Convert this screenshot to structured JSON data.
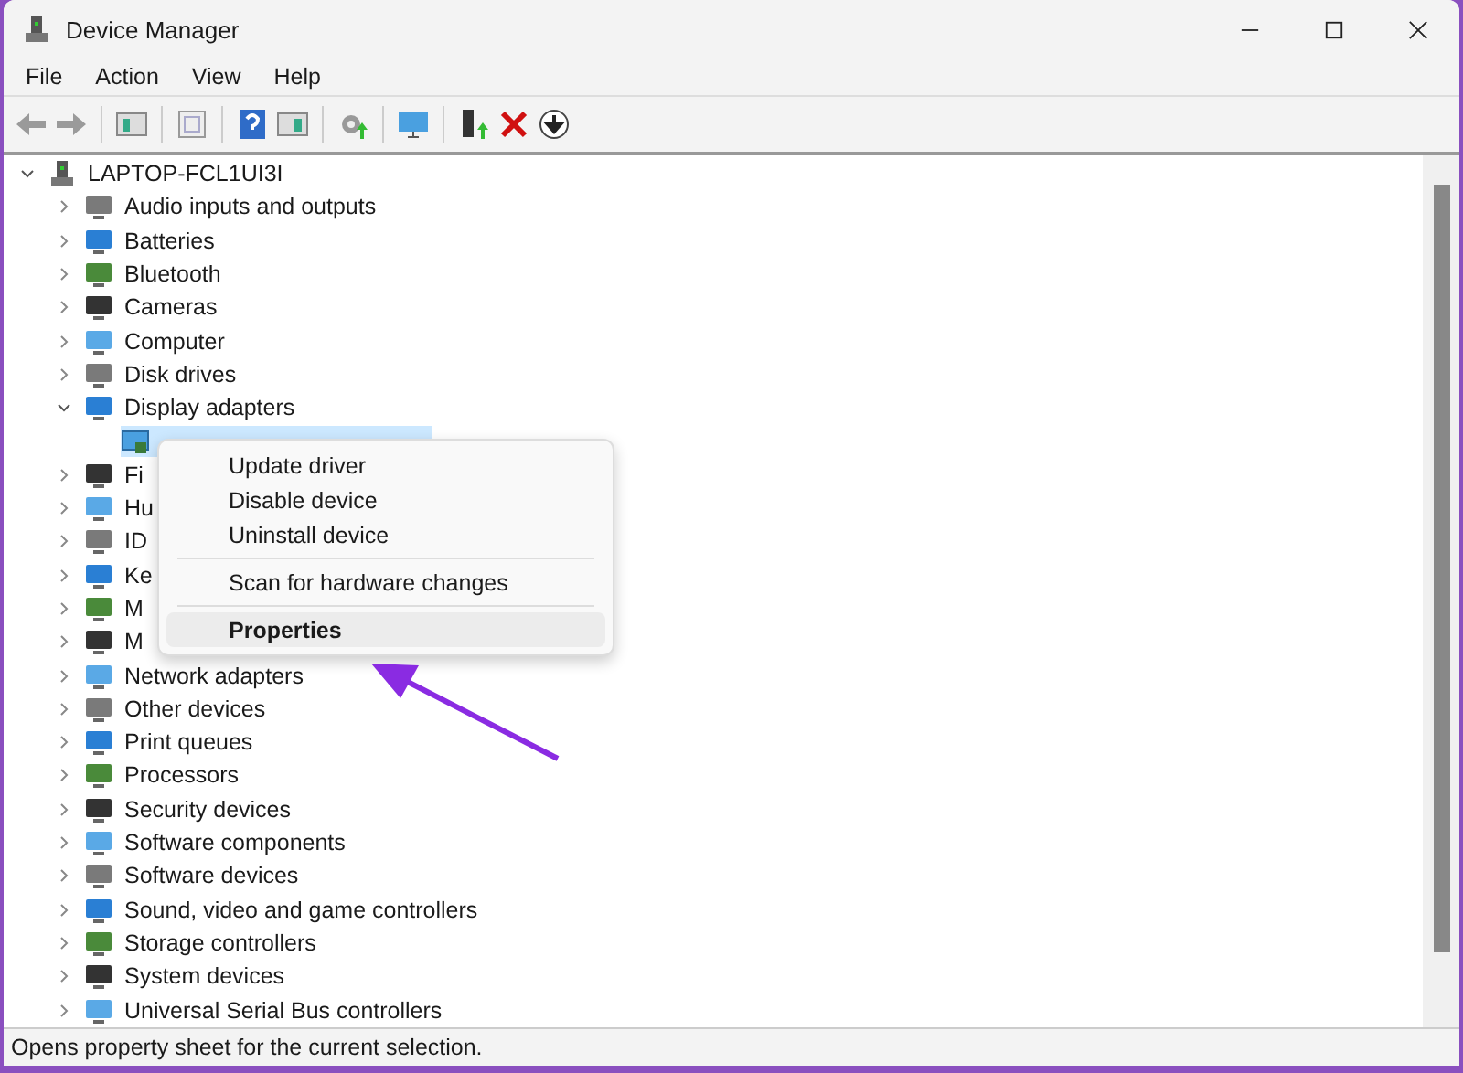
{
  "window": {
    "title": "Device Manager"
  },
  "menu_bar": [
    "File",
    "Action",
    "View",
    "Help"
  ],
  "tree": {
    "label": "LAPTOP-FCL1UI3I",
    "expanded": true,
    "children": [
      {
        "label": "Audio inputs and outputs",
        "expanded": false
      },
      {
        "label": "Batteries",
        "expanded": false
      },
      {
        "label": "Bluetooth",
        "expanded": false
      },
      {
        "label": "Cameras",
        "expanded": false
      },
      {
        "label": "Computer",
        "expanded": false
      },
      {
        "label": "Disk drives",
        "expanded": false
      },
      {
        "label": "Display adapters",
        "expanded": true,
        "children": [
          {
            "selected": true
          }
        ]
      },
      {
        "label": "Fi",
        "expanded": false
      },
      {
        "label": "Hu",
        "expanded": false
      },
      {
        "label": "ID",
        "expanded": false
      },
      {
        "label": "Ke",
        "expanded": false
      },
      {
        "label": "M",
        "expanded": false
      },
      {
        "label": "M",
        "expanded": false
      },
      {
        "label": "Network adapters",
        "expanded": false
      },
      {
        "label": "Other devices",
        "expanded": false
      },
      {
        "label": "Print queues",
        "expanded": false
      },
      {
        "label": "Processors",
        "expanded": false
      },
      {
        "label": "Security devices",
        "expanded": false
      },
      {
        "label": "Software components",
        "expanded": false
      },
      {
        "label": "Software devices",
        "expanded": false
      },
      {
        "label": "Sound, video and game controllers",
        "expanded": false
      },
      {
        "label": "Storage controllers",
        "expanded": false
      },
      {
        "label": "System devices",
        "expanded": false
      },
      {
        "label": "Universal Serial Bus controllers",
        "expanded": false
      }
    ]
  },
  "context_menu": [
    {
      "label": "Update driver",
      "kind": "item",
      "hovered": false
    },
    {
      "label": "Disable device",
      "kind": "item",
      "hovered": false
    },
    {
      "label": "Uninstall device",
      "kind": "item",
      "hovered": false
    },
    {
      "kind": "separator"
    },
    {
      "label": "Scan for hardware changes",
      "kind": "item",
      "hovered": false
    },
    {
      "kind": "separator"
    },
    {
      "label": "Properties",
      "kind": "item",
      "hovered": true
    }
  ],
  "status_bar": "Opens property sheet for the current selection."
}
